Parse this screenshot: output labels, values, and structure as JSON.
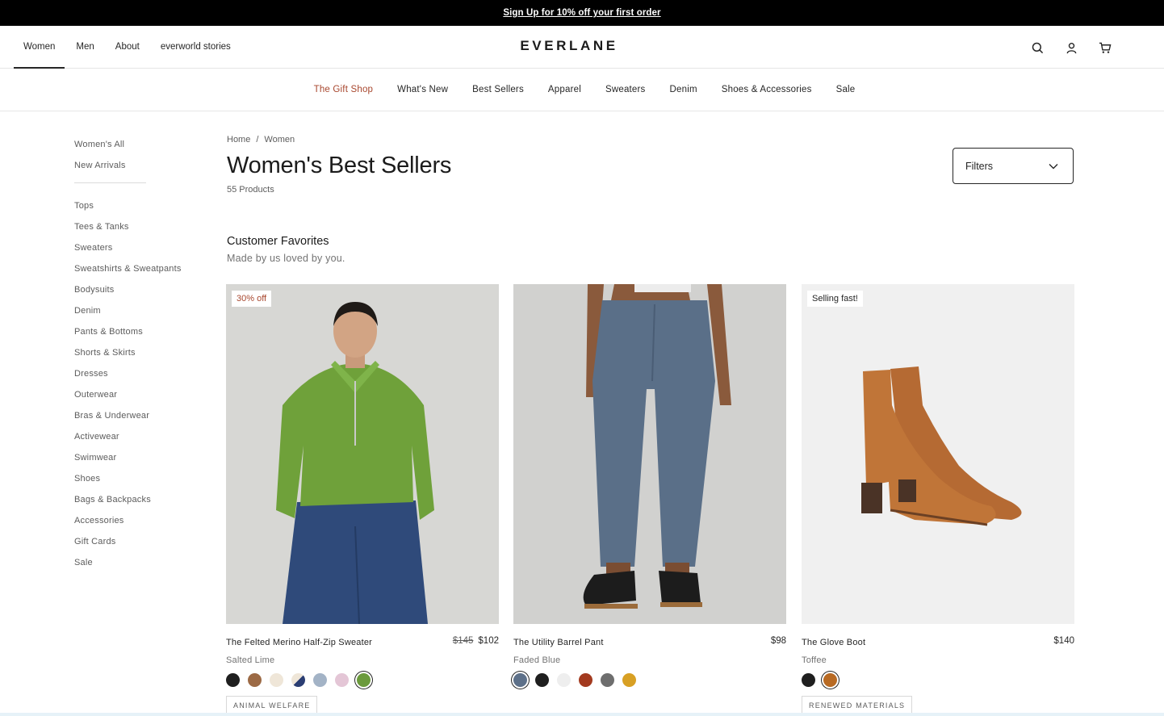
{
  "promo": {
    "text": "Sign Up for 10% off your first order"
  },
  "header": {
    "nav": [
      "Women",
      "Men",
      "About",
      "everworld stories"
    ],
    "logo": "EVERLANE",
    "icons": [
      "search-icon",
      "account-icon",
      "cart-icon"
    ]
  },
  "categories": [
    "The Gift Shop",
    "What's New",
    "Best Sellers",
    "Apparel",
    "Sweaters",
    "Denim",
    "Shoes & Accessories",
    "Sale"
  ],
  "sidebar": {
    "top": [
      "Women's All",
      "New Arrivals"
    ],
    "items": [
      "Tops",
      "Tees & Tanks",
      "Sweaters",
      "Sweatshirts & Sweatpants",
      "Bodysuits",
      "Denim",
      "Pants & Bottoms",
      "Shorts & Skirts",
      "Dresses",
      "Outerwear",
      "Bras & Underwear",
      "Activewear",
      "Swimwear",
      "Shoes",
      "Bags & Backpacks",
      "Accessories",
      "Gift Cards",
      "Sale"
    ]
  },
  "breadcrumb": {
    "home": "Home",
    "sep": "/",
    "current": "Women"
  },
  "page": {
    "title": "Women's Best Sellers",
    "count": "55 Products",
    "filters": "Filters"
  },
  "section": {
    "title": "Customer Favorites",
    "subtitle": "Made by us loved by you."
  },
  "products": [
    {
      "name": "The Felted Merino Half-Zip Sweater",
      "old_price": "$145",
      "price": "$102",
      "color": "Salted Lime",
      "badge": "30% off",
      "tag": "ANIMAL WELFARE",
      "swatches": [
        "#1f1f1f",
        "#9c6a45",
        "#efe6d8",
        "#2b3e73",
        "#a3b3c6",
        "#e4c6d6",
        "#6b9a3c"
      ],
      "selected_swatch": 6
    },
    {
      "name": "The Utility Barrel Pant",
      "old_price": "",
      "price": "$98",
      "color": "Faded Blue",
      "badge": "",
      "tag": "",
      "swatches": [
        "#5d7089",
        "#1f1f1f",
        "#eeeeee",
        "#a33a1f",
        "#6e6e6e",
        "#d8a024"
      ],
      "selected_swatch": 0
    },
    {
      "name": "The Glove Boot",
      "old_price": "",
      "price": "$140",
      "color": "Toffee",
      "badge": "Selling fast!",
      "tag": "RENEWED MATERIALS",
      "swatches": [
        "#1f1f1f",
        "#b86a23"
      ],
      "selected_swatch": 1
    }
  ],
  "colors": {
    "accent": "#a8472e",
    "text": "#262626",
    "muted": "#737373"
  }
}
